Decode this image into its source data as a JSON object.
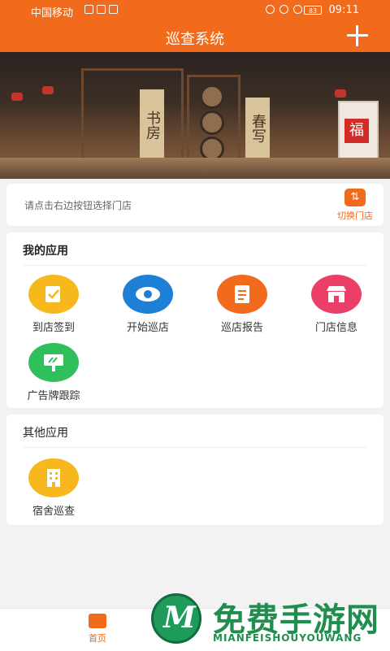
{
  "status_bar": {
    "carrier": "中国移动",
    "battery": "83",
    "time": "09:11"
  },
  "header": {
    "title": "巡查系统"
  },
  "store_selector": {
    "prompt": "请点击右边按钮选择门店",
    "switch_label": "切换门店"
  },
  "my_apps": {
    "title": "我的应用",
    "items": [
      {
        "label": "到店签到",
        "icon": "checkin-icon",
        "color": "#f6b81c"
      },
      {
        "label": "开始巡店",
        "icon": "eye-icon",
        "color": "#1e7fd6"
      },
      {
        "label": "巡店报告",
        "icon": "report-icon",
        "color": "#f26a1b"
      },
      {
        "label": "门店信息",
        "icon": "store-icon",
        "color": "#ec3f67"
      },
      {
        "label": "广告牌跟踪",
        "icon": "billboard-icon",
        "color": "#2fbf5b"
      }
    ]
  },
  "other_apps": {
    "title": "其他应用",
    "items": [
      {
        "label": "宿舍巡查",
        "icon": "building-icon",
        "color": "#f6b81c"
      }
    ]
  },
  "banner_art": {
    "sign_left": "书房",
    "sign_right": "春写",
    "fu": "福"
  },
  "tab_bar": {
    "items": [
      {
        "label": "首页",
        "icon": "home-icon",
        "active_color": "#f26a1b"
      }
    ]
  },
  "watermark": {
    "logo_letter": "M",
    "cn": "免费手游网",
    "en": "MIANFEISHOUYOUWANG"
  }
}
